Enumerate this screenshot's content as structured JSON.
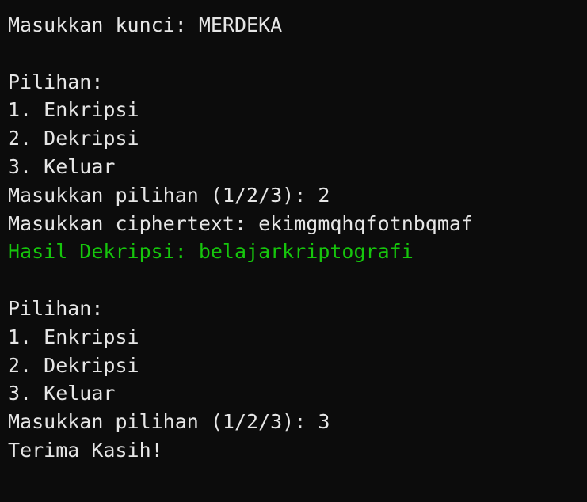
{
  "terminal": {
    "colors": {
      "background": "#0c0c0c",
      "text": "#e6e6e6",
      "success": "#16c60c"
    },
    "lines": [
      {
        "text": "Masukkan kunci: MERDEKA"
      },
      {
        "text": ""
      },
      {
        "text": "Pilihan:"
      },
      {
        "text": "1. Enkripsi"
      },
      {
        "text": "2. Dekripsi"
      },
      {
        "text": "3. Keluar"
      },
      {
        "text": "Masukkan pilihan (1/2/3): 2"
      },
      {
        "text": "Masukkan ciphertext: ekimgmqhqfotnbqmaf"
      },
      {
        "text": "Hasil Dekripsi: belajarkriptografi"
      },
      {
        "text": ""
      },
      {
        "text": "Pilihan:"
      },
      {
        "text": "1. Enkripsi"
      },
      {
        "text": "2. Dekripsi"
      },
      {
        "text": "3. Keluar"
      },
      {
        "text": "Masukkan pilihan (1/2/3): 3"
      },
      {
        "text": "Terima Kasih!"
      }
    ]
  }
}
